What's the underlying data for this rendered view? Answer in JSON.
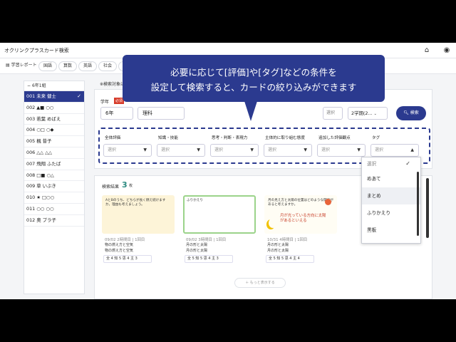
{
  "app": {
    "title": "オクリンクプラスカード検索"
  },
  "tabs": [
    "学習レポート",
    "国語",
    "算数",
    "英語",
    "社会",
    "理"
  ],
  "sidebar": {
    "header": "6年1組",
    "students": [
      {
        "label": "001 未来 健士",
        "active": true
      },
      {
        "label": "002 ▲■ ○○"
      },
      {
        "label": "003 若葉 めばえ"
      },
      {
        "label": "004 ○□ ○◆"
      },
      {
        "label": "005 楓 昔子"
      },
      {
        "label": "006 △△ △△"
      },
      {
        "label": "007 飛翔 ふたば"
      },
      {
        "label": "008 □■ ○△"
      },
      {
        "label": "009 草 いぶき"
      },
      {
        "label": "010 ★ □○○"
      },
      {
        "label": "011 ○○ ○○"
      },
      {
        "label": "012 奥 プラ子"
      }
    ]
  },
  "filters": {
    "hint": "※検索対象は",
    "grade_label": "学年",
    "required": "必須",
    "grade_value": "6年",
    "subject_value": "理科",
    "sel3_value": "選択",
    "term_value": "2学期(2...",
    "search_button": "検索",
    "criteria": [
      {
        "label": "全体評価",
        "placeholder": "選択"
      },
      {
        "label": "知識・技能",
        "placeholder": "選択"
      },
      {
        "label": "思考・判断・表現力",
        "placeholder": "選択"
      },
      {
        "label": "主体的に取り組む態度",
        "placeholder": "選択"
      },
      {
        "label": "追加した評価観点",
        "placeholder": "選択"
      },
      {
        "label": "タグ",
        "placeholder": "選択"
      }
    ]
  },
  "results": {
    "label": "検索結果",
    "count": "3",
    "unit": "枚",
    "more": "もっと表示する",
    "cards": [
      {
        "thumb_text": "AとBのうち、どちらが長く燃え続けますか。理由も考えましょう。",
        "date": "09/02 2時間目 | 1回目",
        "line1": "物の燃え方と空気",
        "line2": "物の燃え方と空気",
        "eval": "全 4 知 5 思 4 主 3",
        "thumb_bg": "#fdf4d8",
        "border": "#fdf4d8"
      },
      {
        "thumb_text": "ふりかえり",
        "date": "09/02 3時間目 | 1回目",
        "line1": "月の形と太陽",
        "line2": "月の形と太陽",
        "eval": "全 5 知 5 思 4 主 3",
        "thumb_bg": "#ffffff",
        "border": "#9bd38a"
      },
      {
        "thumb_text": "月の見え方と太陽の位置はどのような関係があると考えますか。",
        "date": "10/31 4時間目 | 1回目",
        "line1": "月の形と太陽",
        "line2": "月の形と太陽",
        "eval": "全 5 知 5 思 4 主 4",
        "thumb_bg": "#fffdf4",
        "border": "#fffdf4",
        "overlay": "月が光っている方向に太陽があるといえる"
      }
    ]
  },
  "tag_dropdown": {
    "selected": "選択",
    "options": [
      "めあて",
      "まとめ",
      "ふりかえり",
      "黒板"
    ]
  },
  "callout": {
    "line1": "必要に応じて[評価]や[タグ]などの条件を",
    "line2": "設定して検索すると、カードの絞り込みができます"
  },
  "colors": {
    "accent": "#2b3a8f",
    "required": "#d63b2a",
    "count": "#2b8a80"
  }
}
